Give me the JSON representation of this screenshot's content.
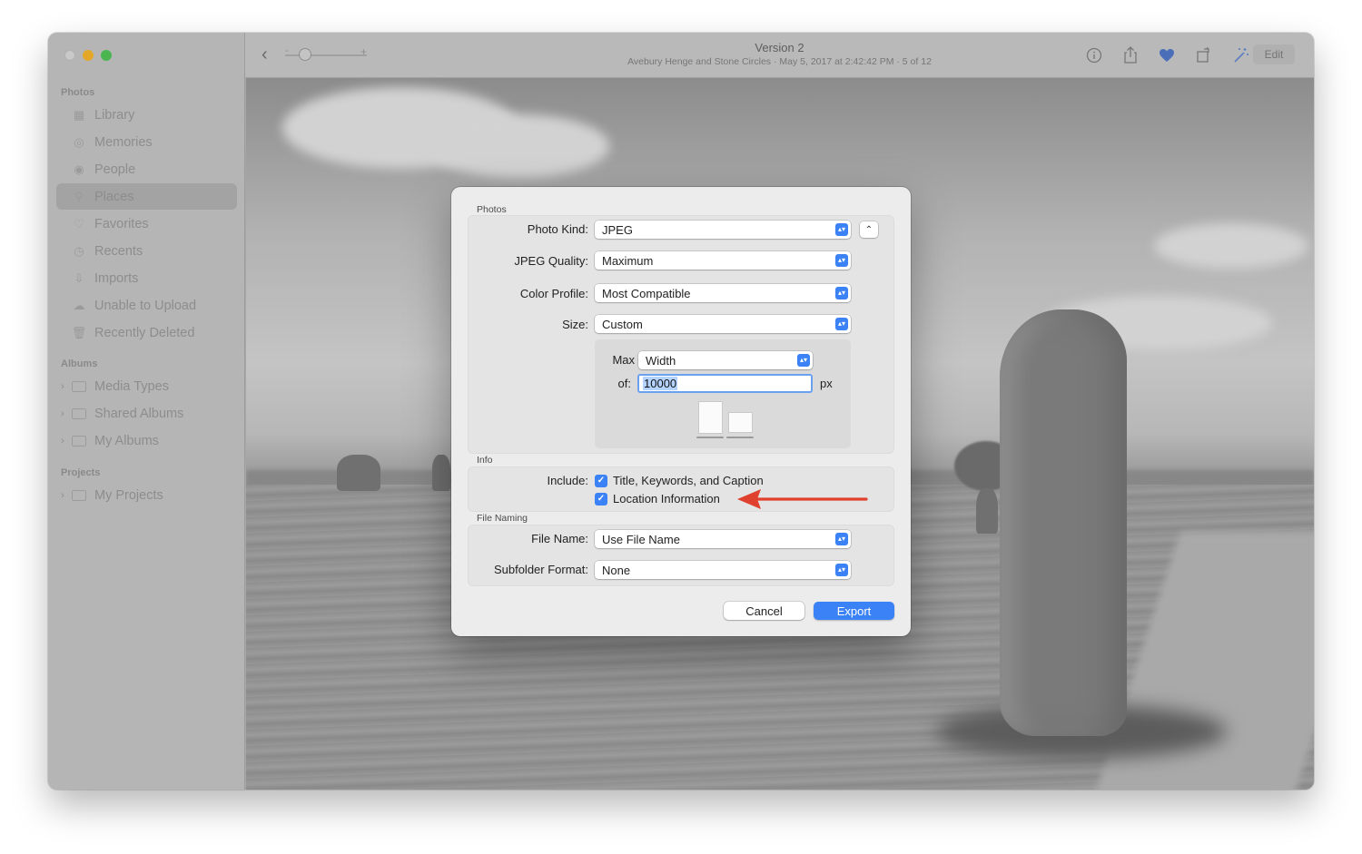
{
  "colors": {
    "accent": "#3b82f6",
    "arrow": "#e0412e"
  },
  "toolbar": {
    "title": "Version 2",
    "subtitle": "Avebury Henge and Stone Circles  ·  May 5, 2017 at 2:42:42 PM  ·  5 of 12",
    "zoom_minus": "-",
    "zoom_plus": "+",
    "edit_label": "Edit",
    "icons": [
      "back-icon",
      "info-icon",
      "share-icon",
      "heart-icon",
      "rotate-icon",
      "enhance-icon"
    ]
  },
  "sidebar": {
    "sections": {
      "photos": "Photos",
      "albums": "Albums",
      "projects": "Projects"
    },
    "items": [
      {
        "label": "Library",
        "icon": "library-icon"
      },
      {
        "label": "Memories",
        "icon": "memories-icon"
      },
      {
        "label": "People",
        "icon": "people-icon"
      },
      {
        "label": "Places",
        "icon": "places-icon",
        "selected": true
      },
      {
        "label": "Favorites",
        "icon": "heart-icon"
      },
      {
        "label": "Recents",
        "icon": "clock-icon"
      },
      {
        "label": "Imports",
        "icon": "import-icon"
      },
      {
        "label": "Unable to Upload",
        "icon": "cloud-icon"
      },
      {
        "label": "Recently Deleted",
        "icon": "trash-icon"
      }
    ],
    "album_groups": [
      {
        "label": "Media Types"
      },
      {
        "label": "Shared Albums"
      },
      {
        "label": "My Albums"
      }
    ],
    "project_groups": [
      {
        "label": "My Projects"
      }
    ]
  },
  "dialog": {
    "photos_section": "Photos",
    "photo_kind": {
      "label": "Photo Kind:",
      "value": "JPEG"
    },
    "jpeg_quality": {
      "label": "JPEG Quality:",
      "value": "Maximum"
    },
    "color_profile": {
      "label": "Color Profile:",
      "value": "Most Compatible"
    },
    "size": {
      "label": "Size:",
      "value": "Custom"
    },
    "max": {
      "label": "Max",
      "value": "Width"
    },
    "of": {
      "label": "of:",
      "value": "10000",
      "unit": "px"
    },
    "info_section": "Info",
    "include_label": "Include:",
    "include_options": [
      {
        "label": "Title, Keywords, and Caption",
        "checked": true
      },
      {
        "label": "Location Information",
        "checked": true
      }
    ],
    "file_naming_section": "File Naming",
    "file_name": {
      "label": "File Name:",
      "value": "Use File Name"
    },
    "subfolder_format": {
      "label": "Subfolder Format:",
      "value": "None"
    },
    "cancel_label": "Cancel",
    "export_label": "Export"
  }
}
